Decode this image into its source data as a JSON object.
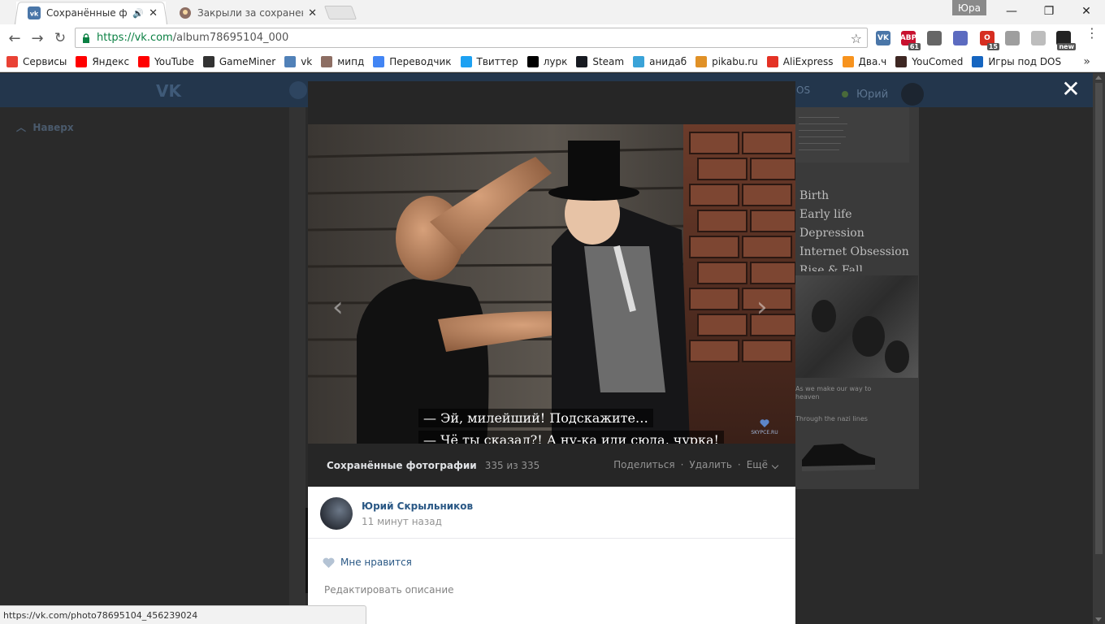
{
  "browser": {
    "tabs": [
      {
        "title": "Сохранённые фотогр",
        "active": true,
        "has_audio": true
      },
      {
        "title": "Закрыли за сохраненку",
        "active": false,
        "has_audio": false
      }
    ],
    "profile_name": "Юра",
    "url_host": "https://vk.com",
    "url_path": "/album78695104_000",
    "extensions": [
      {
        "name": "vk-ext-icon",
        "color": "#4a76a8",
        "label": "VK"
      },
      {
        "name": "adblock-icon",
        "color": "#c8102e",
        "label": "ABP",
        "badge": "61"
      },
      {
        "name": "eye-ext-icon",
        "color": "#666666",
        "label": ""
      },
      {
        "name": "drive-ext-icon",
        "color": "#5c6bc0",
        "label": ""
      },
      {
        "name": "opera-ext-icon",
        "color": "#d62d20",
        "label": "O",
        "badge": "15"
      },
      {
        "name": "lock-ext-icon",
        "color": "#9e9e9e",
        "label": ""
      },
      {
        "name": "tampermonkey-ext-icon",
        "color": "#bdbdbd",
        "label": ""
      },
      {
        "name": "mail-ext-icon",
        "color": "#222222",
        "label": "",
        "badge": "new"
      }
    ],
    "bookmarks": [
      {
        "label": "Сервисы",
        "icon": "apps-grid-icon",
        "color": "#e94235"
      },
      {
        "label": "Яндекс",
        "icon": "yandex-icon",
        "color": "#ff0000"
      },
      {
        "label": "YouTube",
        "icon": "youtube-icon",
        "color": "#ff0000"
      },
      {
        "label": "GameMiner",
        "icon": "gameminer-icon",
        "color": "#333333"
      },
      {
        "label": "vk",
        "icon": "vk-video-icon",
        "color": "#5181b8"
      },
      {
        "label": "мипд",
        "icon": "mipd-icon",
        "color": "#8d6e63"
      },
      {
        "label": "Переводчик",
        "icon": "translate-icon",
        "color": "#4285f4"
      },
      {
        "label": "Твиттер",
        "icon": "twitter-icon",
        "color": "#1da1f2"
      },
      {
        "label": "лурк",
        "icon": "lurk-icon",
        "color": "#000000"
      },
      {
        "label": "Steam",
        "icon": "steam-icon",
        "color": "#171a21"
      },
      {
        "label": "анидаб",
        "icon": "anidub-icon",
        "color": "#3aa3d8"
      },
      {
        "label": "pikabu.ru",
        "icon": "pikabu-icon",
        "color": "#e09127"
      },
      {
        "label": "AliExpress",
        "icon": "aliexpress-icon",
        "color": "#e43225"
      },
      {
        "label": "Два.ч",
        "icon": "dvach-icon",
        "color": "#f7931e"
      },
      {
        "label": "YouComed",
        "icon": "youcomed-icon",
        "color": "#3e2723"
      },
      {
        "label": "Игры под DOS",
        "icon": "dos-games-icon",
        "color": "#1565c0"
      }
    ],
    "status_url": "https://vk.com/photo78695104_456239024"
  },
  "vk": {
    "logo_text": "VK",
    "user_name": "Юрий",
    "os_text": "OS",
    "back_to_top": "Наверх",
    "bg_toc": [
      "Birth",
      "Early life",
      "Depression",
      "Internet Obsession",
      "Rise & Fall"
    ],
    "bg_caption1": "As we make our way to heaven",
    "bg_caption2": "Through the nazi lines"
  },
  "viewer": {
    "subtitle_line1": "— Эй, милейший! Подскажите…",
    "subtitle_line2": "— Чё ты сказал?! А ну-ка иди сюда, чурка!",
    "watermark": "SKYPCE.RU",
    "album_title": "Сохранённые фотографии",
    "album_count": "335 из 335",
    "action_share": "Поделиться",
    "action_delete": "Удалить",
    "action_more": "Ещё",
    "author_name": "Юрий Скрыльников",
    "author_time": "11 минут назад",
    "like_label": "Мне нравится",
    "edit_description": "Редактировать описание",
    "close_symbol": "✕"
  },
  "colors": {
    "vk_link": "#2a5885",
    "vk_header": "#23364c",
    "viewer_bar": "#262626",
    "url_green": "#0b8043"
  }
}
